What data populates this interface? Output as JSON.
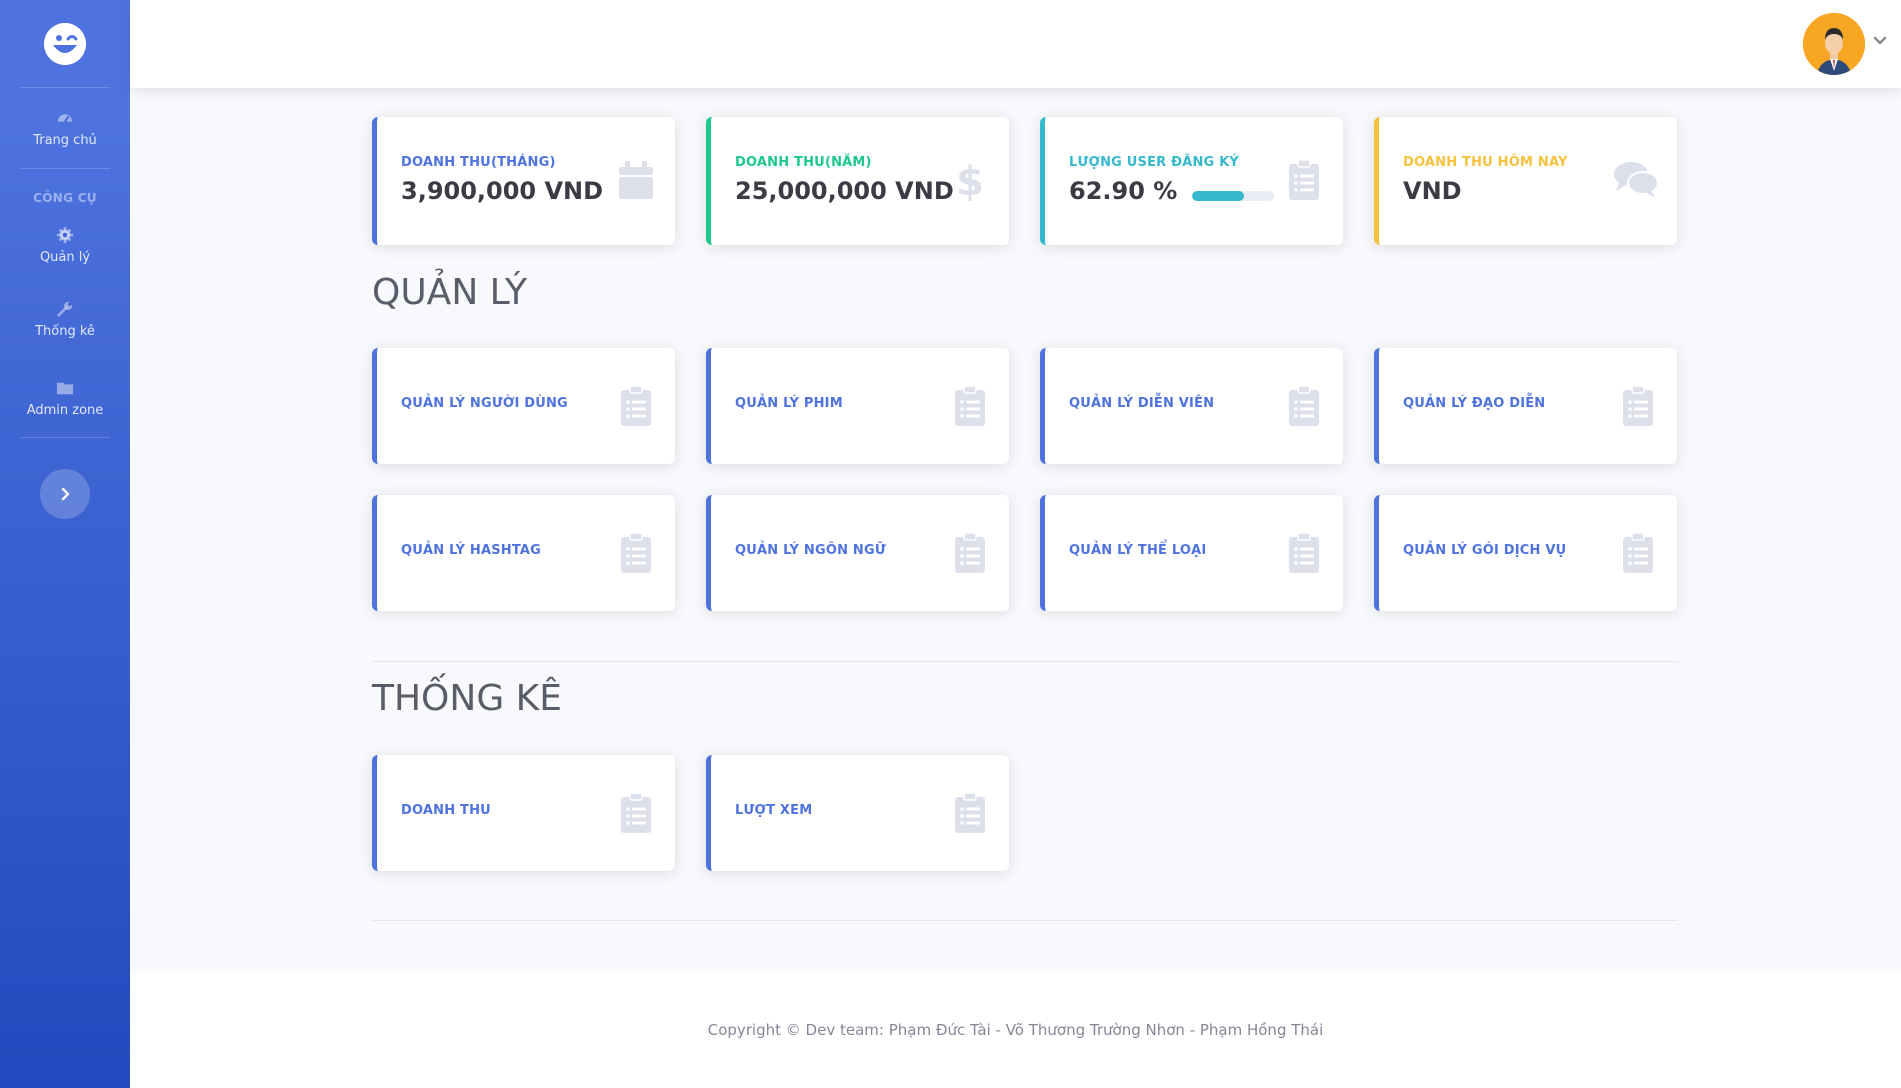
{
  "sidebar": {
    "logo_icon": "wink-smiley-logo",
    "items": [
      {
        "label": "Trang chủ",
        "icon": "tachometer-icon"
      },
      {
        "label": "Quản lý",
        "icon": "gear-icon"
      },
      {
        "label": "Thống kê",
        "icon": "wrench-icon"
      },
      {
        "label": "Admin zone",
        "icon": "folder-icon"
      }
    ],
    "heading": "CÔNG CỤ",
    "toggle_icon": "chevron-right-icon"
  },
  "topbar": {
    "avatar_icon": "user-avatar",
    "dropdown_icon": "chevron-down-icon"
  },
  "stats": [
    {
      "label": "DOANH THU(THÁNG)",
      "value": "3,900,000 VND",
      "color": "#4e73df",
      "icon": "calendar-icon"
    },
    {
      "label": "DOANH THU(NĂM)",
      "value": "25,000,000 VND",
      "color": "#1cc88a",
      "icon": "dollar-icon"
    },
    {
      "label": "LƯỢNG USER ĐĂNG KÝ",
      "value": "62.90 %",
      "progress": 0.629,
      "color": "#36b9cc",
      "icon": "clipboard-list-icon"
    },
    {
      "label": "DOANH THU HÔM NAY",
      "value": "VND",
      "color": "#f6c23e",
      "icon": "comments-icon"
    }
  ],
  "manage": {
    "title": "QUẢN LÝ",
    "items": [
      {
        "label": "QUẢN LÝ NGƯỜI DÙNG"
      },
      {
        "label": "QUẢN LÝ PHIM"
      },
      {
        "label": "QUẢN LÝ DIỄN VIÊN"
      },
      {
        "label": "QUẢN LÝ ĐẠO DIỄN"
      },
      {
        "label": "QUẢN LÝ HASHTAG"
      },
      {
        "label": "QUẢN LÝ NGÔN NGỮ"
      },
      {
        "label": "QUẢN LÝ THỂ LOẠI"
      },
      {
        "label": "QUẢN LÝ GÓI DỊCH VỤ"
      }
    ]
  },
  "statistics": {
    "title": "THỐNG KÊ",
    "items": [
      {
        "label": "DOANH THU"
      },
      {
        "label": "LƯỢT XEM"
      }
    ]
  },
  "footer": {
    "copyright": "Copyright © Dev team: Phạm Đức Tài - Võ Thương Trường Nhơn - Phạm Hồng Thái"
  },
  "colors": {
    "primary": "#4e73df",
    "success": "#1cc88a",
    "info": "#36b9cc",
    "warning": "#f6c23e",
    "icon_muted": "#dddfeb"
  }
}
